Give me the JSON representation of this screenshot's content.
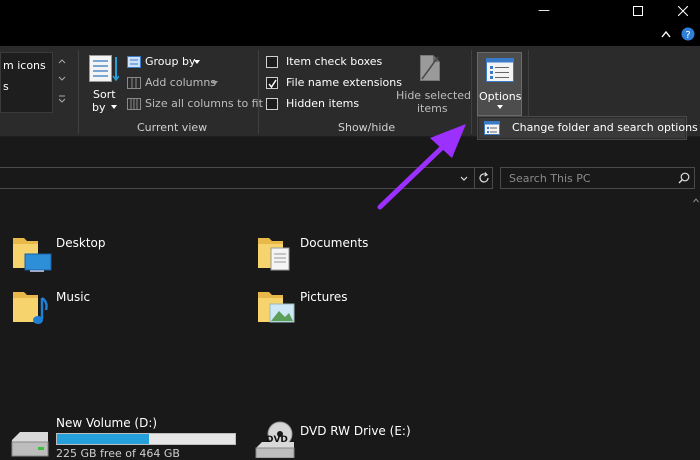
{
  "titlebar": {
    "minimize_glyph": "—",
    "maximize_glyph": "☐",
    "close_glyph": "✕",
    "ribbon_toggle_glyph": "⌃",
    "help_glyph": "?"
  },
  "ribbon": {
    "layout_group": {
      "item_large_icons": "m icons",
      "item_cut": "s"
    },
    "current_view": {
      "sort_by_label_line1": "Sort",
      "sort_by_label_line2": "by",
      "group_by_label": "Group by",
      "add_columns_label": "Add columns",
      "size_columns_label": "Size all columns to fit",
      "group_label": "Current view"
    },
    "show_hide": {
      "item_check_boxes_label": "Item check boxes",
      "file_name_extensions_label": "File name extensions",
      "hidden_items_label": "Hidden items",
      "item_check_boxes_checked": false,
      "file_name_extensions_checked": true,
      "hidden_items_checked": false,
      "hide_selected_line1": "Hide selected",
      "hide_selected_line2": "items",
      "group_label": "Show/hide"
    },
    "options": {
      "label": "Options"
    }
  },
  "popup": {
    "change_folder_label": "Change folder and search options"
  },
  "address": {
    "search_placeholder": "Search This PC"
  },
  "folders": [
    {
      "name": "Desktop",
      "icon": "desktop-folder-icon"
    },
    {
      "name": "Documents",
      "icon": "documents-folder-icon"
    },
    {
      "name": "Music",
      "icon": "music-folder-icon"
    },
    {
      "name": "Pictures",
      "icon": "pictures-folder-icon"
    }
  ],
  "drives": [
    {
      "name": "New Volume (D:)",
      "free_text": "225 GB free of 464 GB",
      "used_fraction": 0.515
    },
    {
      "name": "DVD RW Drive (E:)",
      "badge": "DVD"
    }
  ],
  "colors": {
    "accent": "#26a0da",
    "arrow": "#9b30ff",
    "ribbon_bg": "#2b2b2b",
    "content_bg": "#191919"
  }
}
